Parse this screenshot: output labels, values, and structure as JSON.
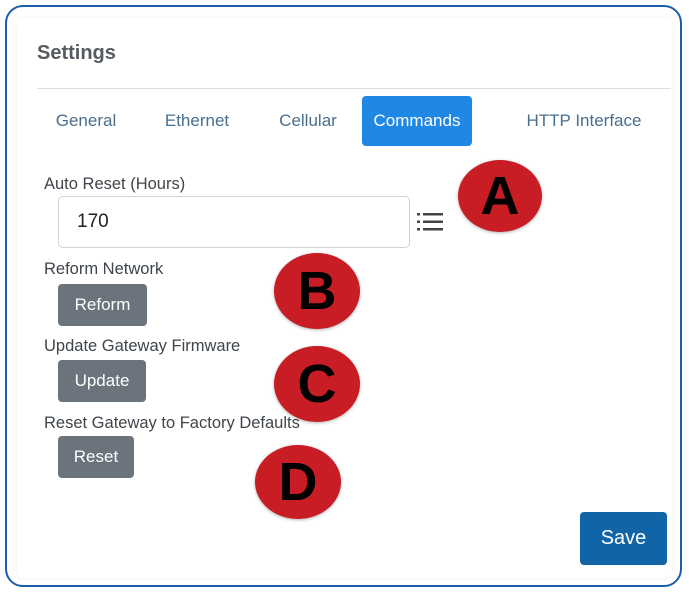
{
  "header": {
    "title": "Settings"
  },
  "tabs": [
    {
      "label": "General",
      "active": false
    },
    {
      "label": "Ethernet",
      "active": false
    },
    {
      "label": "Cellular",
      "active": false
    },
    {
      "label": "Commands",
      "active": true
    },
    {
      "label": "HTTP Interface",
      "active": false
    }
  ],
  "auto_reset": {
    "label": "Auto Reset (Hours)",
    "value": "170",
    "icon": "list-icon"
  },
  "reform": {
    "label": "Reform Network",
    "button": "Reform"
  },
  "update": {
    "label": "Update Gateway Firmware",
    "button": "Update"
  },
  "reset": {
    "label": "Reset Gateway to Factory Defaults",
    "button": "Reset"
  },
  "save_label": "Save",
  "markers": [
    "A",
    "B",
    "C",
    "D"
  ],
  "colors": {
    "active_tab": "#1f88e5",
    "secondary_button": "#6b747c",
    "save_button": "#1164a6",
    "marker": "#c81d24",
    "frame_border": "#1b5ea8"
  }
}
